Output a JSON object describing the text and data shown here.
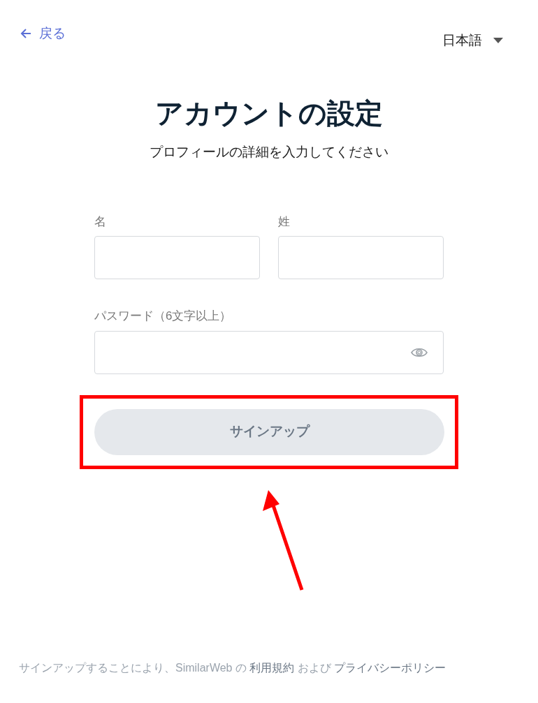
{
  "back_link": {
    "label": "戻る"
  },
  "language_menu": {
    "label": "日本語"
  },
  "title": "アカウントの設定",
  "subtitle": "プロフィールの詳細を入力してください",
  "fields": [
    {
      "label": "名",
      "kind": "text"
    },
    {
      "label": "姓",
      "kind": "text"
    },
    {
      "label": "パスワード（6文字以上）",
      "kind": "password"
    }
  ],
  "signup_button": {
    "label": "サインアップ",
    "disabled": true
  },
  "annotation": {
    "kind": "box-and-arrow",
    "color": "#ff0000"
  },
  "footer": {
    "text": "サインアップすることにより、SimilarWeb の",
    "links": [
      "利用規約",
      "プライバシーポリシー"
    ],
    "joiner": "および"
  }
}
